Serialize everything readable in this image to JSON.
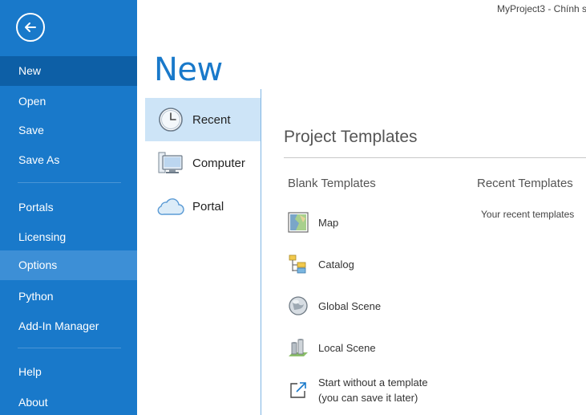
{
  "window": {
    "title": "MyProject3 - Chính s"
  },
  "sidebar": {
    "back_icon": "arrow-left-icon",
    "items": [
      {
        "label": "New"
      },
      {
        "label": "Open"
      },
      {
        "label": "Save"
      },
      {
        "label": "Save As"
      },
      {
        "label": "Portals"
      },
      {
        "label": "Licensing"
      },
      {
        "label": "Options"
      },
      {
        "label": "Python"
      },
      {
        "label": "Add-In Manager"
      },
      {
        "label": "Help"
      },
      {
        "label": "About"
      }
    ],
    "active": "New",
    "hover": "Options",
    "colors": {
      "background": "#1979ca",
      "active": "#0d5fa6",
      "hover": "#3d8fd6"
    }
  },
  "main": {
    "heading": "New",
    "locations": [
      {
        "label": "Recent",
        "icon": "clock-icon",
        "selected": true
      },
      {
        "label": "Computer",
        "icon": "computer-icon",
        "selected": false
      },
      {
        "label": "Portal",
        "icon": "cloud-icon",
        "selected": false
      }
    ],
    "templates": {
      "title": "Project Templates",
      "blank_title": "Blank Templates",
      "recent_title": "Recent Templates",
      "recent_note": "Your recent templates",
      "blank": [
        {
          "label": "Map",
          "icon": "map-icon"
        },
        {
          "label": "Catalog",
          "icon": "catalog-icon"
        },
        {
          "label": "Global Scene",
          "icon": "globe-icon"
        },
        {
          "label": "Local Scene",
          "icon": "local-scene-icon"
        }
      ],
      "start_without": {
        "line1": "Start without a template",
        "line2": "(you can save it later)",
        "icon": "open-external-icon"
      }
    }
  }
}
